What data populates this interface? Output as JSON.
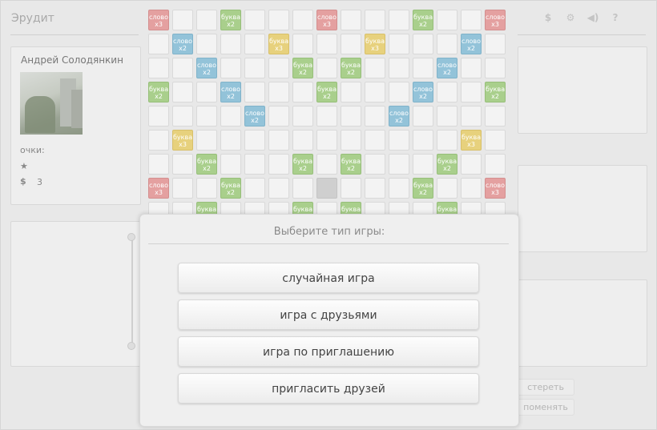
{
  "app": {
    "title": "Эрудит"
  },
  "player": {
    "name": "Андрей Солодянкин",
    "score_label": "очки:",
    "coins": "3"
  },
  "icons": {
    "star": "star-icon",
    "coin": "dollar-icon",
    "top": [
      "dollar-icon",
      "settings-icon",
      "sound-icon",
      "help-icon"
    ]
  },
  "top_icon_glyphs": [
    "$",
    "⚙",
    "◀)",
    "?"
  ],
  "board": {
    "size": 15,
    "bonus_labels": {
      "word3": [
        "слово",
        "x3"
      ],
      "word2": [
        "слово",
        "x2"
      ],
      "letter2": [
        "буква",
        "x2"
      ],
      "letter3": [
        "буква",
        "x3"
      ]
    },
    "colors": {
      "word3": "#e4a0a0",
      "word2": "#93c3d9",
      "letter2": "#a9cf8c",
      "letter3": "#e7d17d"
    },
    "rows": [
      "W..L...W...L..W",
      ".w...T...T...w.",
      "..w...L.L...w..",
      "L..w...L...w..L",
      "....w.....w....",
      ".T...........T.",
      "..L...L.L...L..",
      "W..L...C...L..W",
      "..L...L.L...L.."
    ]
  },
  "side_buttons": {
    "erase": "стереть",
    "change": "поменять"
  },
  "modal": {
    "title": "Выберите тип игры:",
    "options": [
      "случайная игра",
      "игра с друзьями",
      "игра по приглашению",
      "пригласить друзей"
    ]
  }
}
